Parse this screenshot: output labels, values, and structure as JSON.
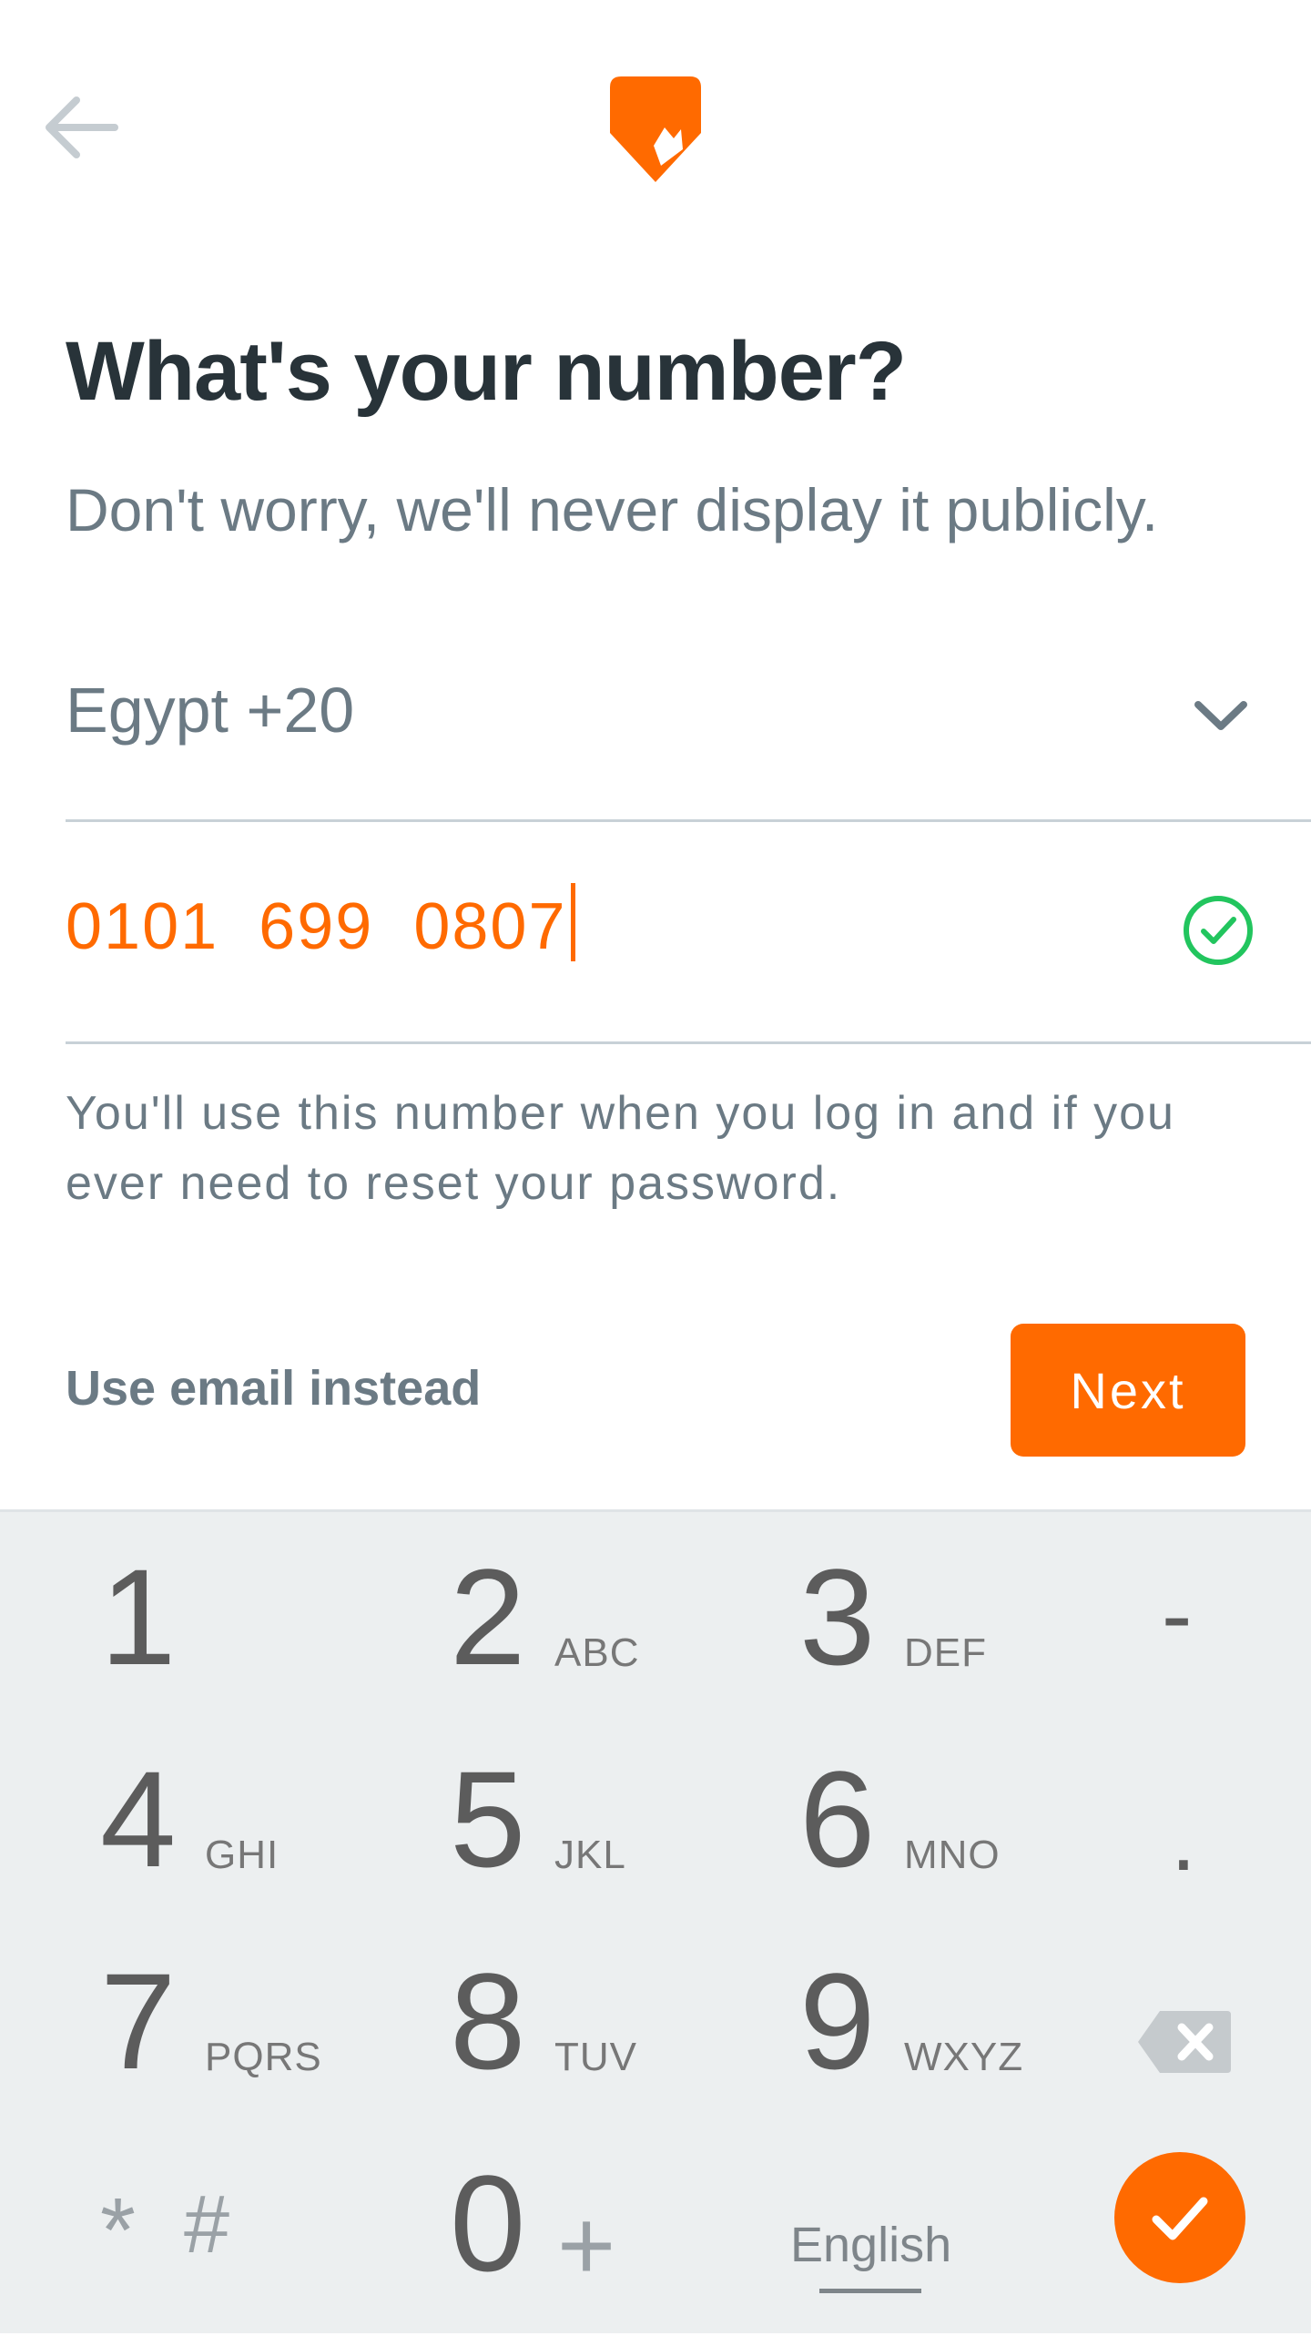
{
  "header": {
    "back_icon": "arrow-left-icon",
    "logo_icon": "brand-logo-icon"
  },
  "colors": {
    "accent": "#ff6a00",
    "valid": "#22c55e",
    "text_dark": "#283339",
    "text_muted": "#6b7a84",
    "keypad_bg": "#eceff0"
  },
  "page": {
    "title": "What's your number?",
    "subtitle": "Don't worry, we'll never display it publicly."
  },
  "form": {
    "country": {
      "selected": "Egypt +20",
      "icon": "chevron-down-icon"
    },
    "phone": {
      "value": "0101  699  0807",
      "valid_icon": "check-circle-icon"
    },
    "helper": "You'll use this number when you log in and if you ever need to reset your password."
  },
  "actions": {
    "email_link": "Use email instead",
    "next_label": "Next"
  },
  "keypad": {
    "keys": [
      {
        "digit": "1",
        "letters": ""
      },
      {
        "digit": "2",
        "letters": "ABC"
      },
      {
        "digit": "3",
        "letters": "DEF"
      },
      {
        "digit": "4",
        "letters": "GHI"
      },
      {
        "digit": "5",
        "letters": "JKL"
      },
      {
        "digit": "6",
        "letters": "MNO"
      },
      {
        "digit": "7",
        "letters": "PQRS"
      },
      {
        "digit": "8",
        "letters": "TUV"
      },
      {
        "digit": "9",
        "letters": "WXYZ"
      },
      {
        "digit": "0",
        "letters": "+"
      }
    ],
    "dash": "-",
    "dot": ".",
    "star": "*",
    "hash": "#",
    "language": "English",
    "backspace_icon": "backspace-icon",
    "done_icon": "check-icon"
  }
}
